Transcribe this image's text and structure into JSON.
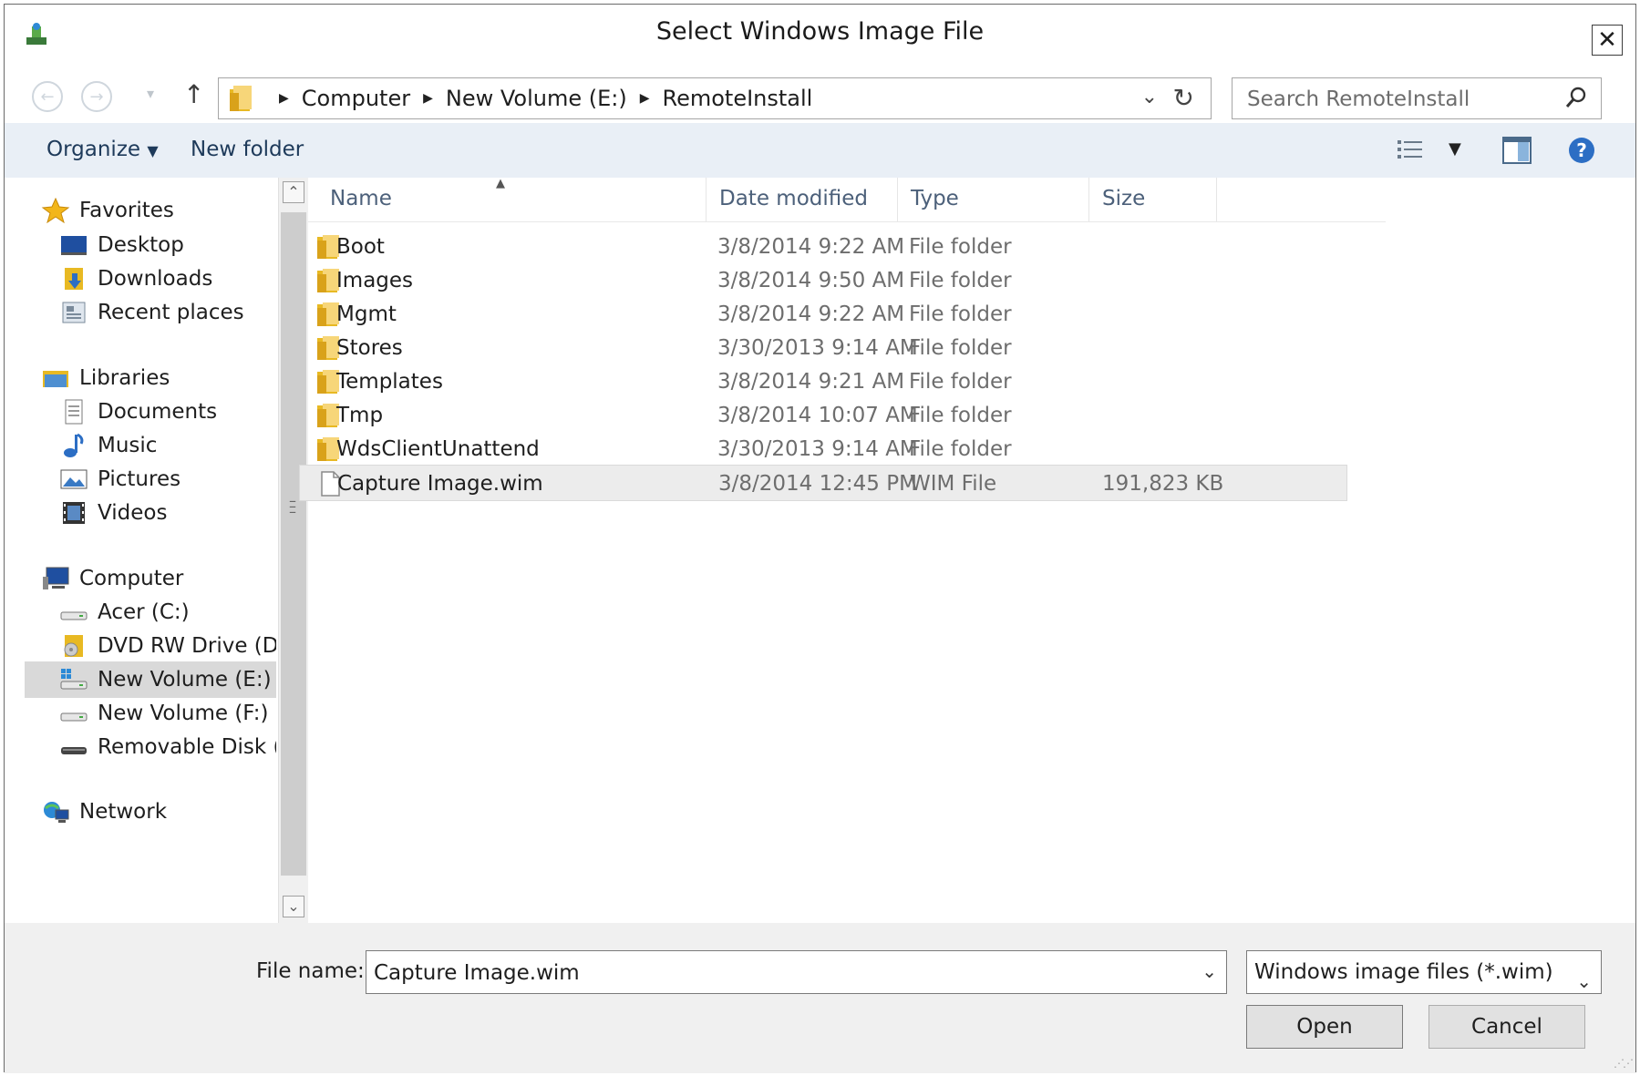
{
  "window": {
    "title": "Select Windows Image File"
  },
  "address_bar": {
    "breadcrumbs": [
      "Computer",
      "New Volume (E:)",
      "RemoteInstall"
    ]
  },
  "search": {
    "placeholder": "Search RemoteInstall"
  },
  "toolbar": {
    "organize_label": "Organize",
    "new_folder_label": "New folder"
  },
  "nav_pane": {
    "groups": [
      {
        "label": "Favorites",
        "icon": "star-icon",
        "items": [
          {
            "label": "Desktop",
            "icon": "desktop-icon"
          },
          {
            "label": "Downloads",
            "icon": "downloads-icon"
          },
          {
            "label": "Recent places",
            "icon": "recent-places-icon"
          }
        ]
      },
      {
        "label": "Libraries",
        "icon": "libraries-icon",
        "items": [
          {
            "label": "Documents",
            "icon": "documents-icon"
          },
          {
            "label": "Music",
            "icon": "music-icon"
          },
          {
            "label": "Pictures",
            "icon": "pictures-icon"
          },
          {
            "label": "Videos",
            "icon": "videos-icon"
          }
        ]
      },
      {
        "label": "Computer",
        "icon": "computer-icon",
        "items": [
          {
            "label": "Acer (C:)",
            "icon": "drive-icon"
          },
          {
            "label": "DVD RW Drive (D",
            "icon": "dvd-drive-icon"
          },
          {
            "label": "New Volume (E:)",
            "icon": "network-drive-icon",
            "selected": true
          },
          {
            "label": "New Volume (F:)",
            "icon": "drive-icon"
          },
          {
            "label": "Removable Disk (",
            "icon": "removable-disk-icon"
          }
        ]
      },
      {
        "label": "Network",
        "icon": "network-icon",
        "items": []
      }
    ]
  },
  "file_list": {
    "columns": [
      "Name",
      "Date modified",
      "Type",
      "Size"
    ],
    "rows": [
      {
        "name": "Boot",
        "date": "3/8/2014 9:22 AM",
        "type": "File folder",
        "size": "",
        "icon": "folder-icon"
      },
      {
        "name": "Images",
        "date": "3/8/2014 9:50 AM",
        "type": "File folder",
        "size": "",
        "icon": "folder-icon"
      },
      {
        "name": "Mgmt",
        "date": "3/8/2014 9:22 AM",
        "type": "File folder",
        "size": "",
        "icon": "folder-icon"
      },
      {
        "name": "Stores",
        "date": "3/30/2013 9:14 AM",
        "type": "File folder",
        "size": "",
        "icon": "folder-icon"
      },
      {
        "name": "Templates",
        "date": "3/8/2014 9:21 AM",
        "type": "File folder",
        "size": "",
        "icon": "folder-icon"
      },
      {
        "name": "Tmp",
        "date": "3/8/2014 10:07 AM",
        "type": "File folder",
        "size": "",
        "icon": "folder-icon"
      },
      {
        "name": "WdsClientUnattend",
        "date": "3/30/2013 9:14 AM",
        "type": "File folder",
        "size": "",
        "icon": "folder-icon"
      },
      {
        "name": "Capture Image.wim",
        "date": "3/8/2014 12:45 PM",
        "type": "WIM File",
        "size": "191,823 KB",
        "icon": "file-icon",
        "selected": true
      }
    ]
  },
  "bottom": {
    "file_name_label": "File name:",
    "file_name_value": "Capture Image.wim",
    "filter_value": "Windows image files (*.wim)",
    "open_label": "Open",
    "cancel_label": "Cancel"
  },
  "colors": {
    "accent": "#1e3a5a",
    "toolbar_bg": "#e9eff6",
    "selection": "#d9d9d9"
  }
}
